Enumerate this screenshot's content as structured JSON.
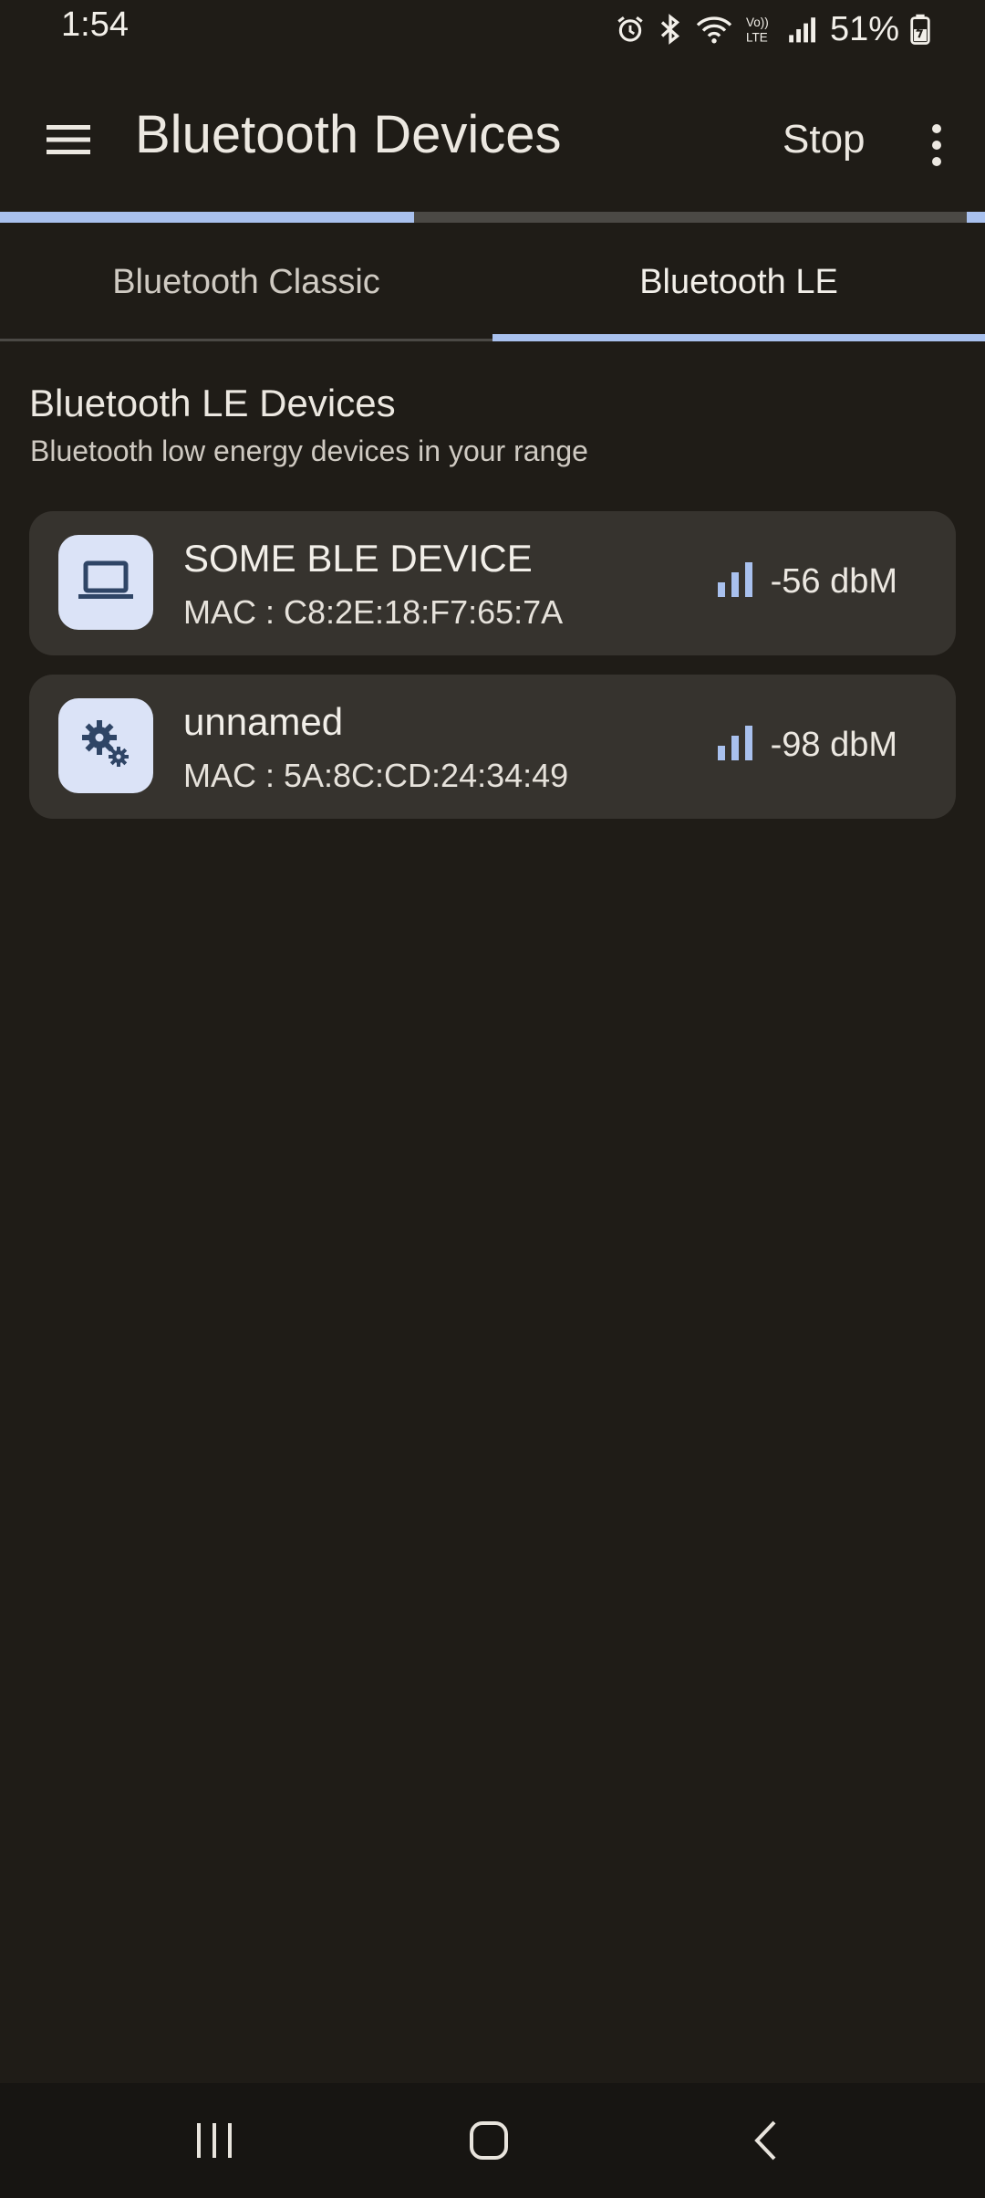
{
  "status_bar": {
    "time": "1:54",
    "battery": "51%",
    "icons": [
      "alarm-icon",
      "bluetooth-icon",
      "wifi-icon",
      "volte-icon",
      "cell-signal-icon",
      "battery-charging-icon"
    ]
  },
  "app_bar": {
    "title": "Bluetooth Devices",
    "stop_label": "Stop",
    "menu_icon": "hamburger-menu-icon",
    "overflow_icon": "more-vert-icon"
  },
  "progress": {
    "value_fraction": 0.42,
    "color": "#a9c1ee"
  },
  "tabs": [
    {
      "label": "Bluetooth Classic",
      "selected": false
    },
    {
      "label": "Bluetooth LE",
      "selected": true
    }
  ],
  "section": {
    "title": "Bluetooth LE Devices",
    "subtitle": "Bluetooth low energy devices in your range"
  },
  "devices": [
    {
      "name": "SOME BLE DEVICE",
      "mac": "MAC : C8:2E:18:F7:65:7A",
      "rssi": "-56 dbM",
      "icon": "laptop-icon"
    },
    {
      "name": "unnamed",
      "mac": "MAC : 5A:8C:CD:24:34:49",
      "rssi": "-98 dbM",
      "icon": "settings-gears-icon"
    }
  ],
  "nav_bar": {
    "icons": [
      "recents-icon",
      "home-icon",
      "back-icon"
    ]
  },
  "colors": {
    "background": "#1f1c17",
    "card": "#36332e",
    "accent": "#a9c1ee",
    "icon_box": "#dbe3f7"
  }
}
